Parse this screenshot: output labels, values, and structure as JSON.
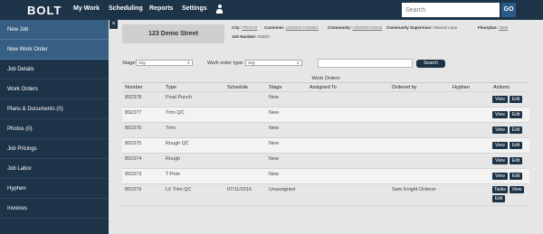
{
  "topbar": {
    "logo": "BOLT",
    "nav": [
      "My Work",
      "Scheduling",
      "Reports",
      "Settings"
    ],
    "user_icon": "user-icon",
    "search_placeholder": "Search",
    "go_label": "GO"
  },
  "sidebar": {
    "items": [
      {
        "label": "New Job"
      },
      {
        "label": "New Work Order"
      },
      {
        "label": "Job Details"
      },
      {
        "label": "Work Orders"
      },
      {
        "label": "Plans & Documents (0)"
      },
      {
        "label": "Photos (0)"
      },
      {
        "label": "Job Pricings"
      },
      {
        "label": "Job Labor"
      },
      {
        "label": "Hyphen"
      },
      {
        "label": "Invoices"
      }
    ],
    "close_label": "×"
  },
  "job": {
    "address": "123 Demo Street",
    "city_label": "City:",
    "city": "FRISCO",
    "customer_label": "Customer:",
    "customer": "LENNAR HOMES",
    "community_label": "Community:",
    "community": "CROWN RIDGE",
    "supervisor_label": "Community Supervisor:",
    "supervisor": "Manuel Lepe",
    "floorplan_label": "Floorplan:",
    "floorplan": "3660",
    "job_number_label": "Job Number:",
    "job_number": "83603"
  },
  "filters": {
    "stage_label": "Stage:",
    "stage_value": "Any",
    "type_label": "Work order type:",
    "type_value": "Any",
    "search_value": "",
    "search_button": "Search"
  },
  "table": {
    "title": "Work Orders",
    "headers": [
      "Number",
      "Type",
      "Schedule",
      "Stage",
      "Assigned To",
      "Ordered by",
      "Hyphen",
      "Actions"
    ],
    "rows": [
      {
        "number": "892378",
        "type": "Final Punch",
        "schedule": "",
        "stage": "New",
        "assigned": "",
        "ordered": "",
        "hyphen": ""
      },
      {
        "number": "892377",
        "type": "Trim QC",
        "schedule": "",
        "stage": "New",
        "assigned": "",
        "ordered": "",
        "hyphen": ""
      },
      {
        "number": "892376",
        "type": "Trim",
        "schedule": "",
        "stage": "New",
        "assigned": "",
        "ordered": "",
        "hyphen": ""
      },
      {
        "number": "892375",
        "type": "Rough QC",
        "schedule": "",
        "stage": "New",
        "assigned": "",
        "ordered": "",
        "hyphen": ""
      },
      {
        "number": "892374",
        "type": "Rough",
        "schedule": "",
        "stage": "New",
        "assigned": "",
        "ordered": "",
        "hyphen": ""
      },
      {
        "number": "892373",
        "type": "T-Pole",
        "schedule": "",
        "stage": "New",
        "assigned": "",
        "ordered": "",
        "hyphen": ""
      },
      {
        "number": "892379",
        "type": "LV Trim QC",
        "schedule": "07/11/2016",
        "stage": "Unassigned",
        "assigned": "",
        "ordered": "Sam Knight Orderer",
        "hyphen": ""
      }
    ],
    "actions": {
      "view": "View",
      "edit": "Edit",
      "tasks": "Tasks"
    }
  },
  "colors": {
    "nav_bg": "#1d3347",
    "highlight": "#375f84",
    "page_bg": "#e6e6e6"
  }
}
